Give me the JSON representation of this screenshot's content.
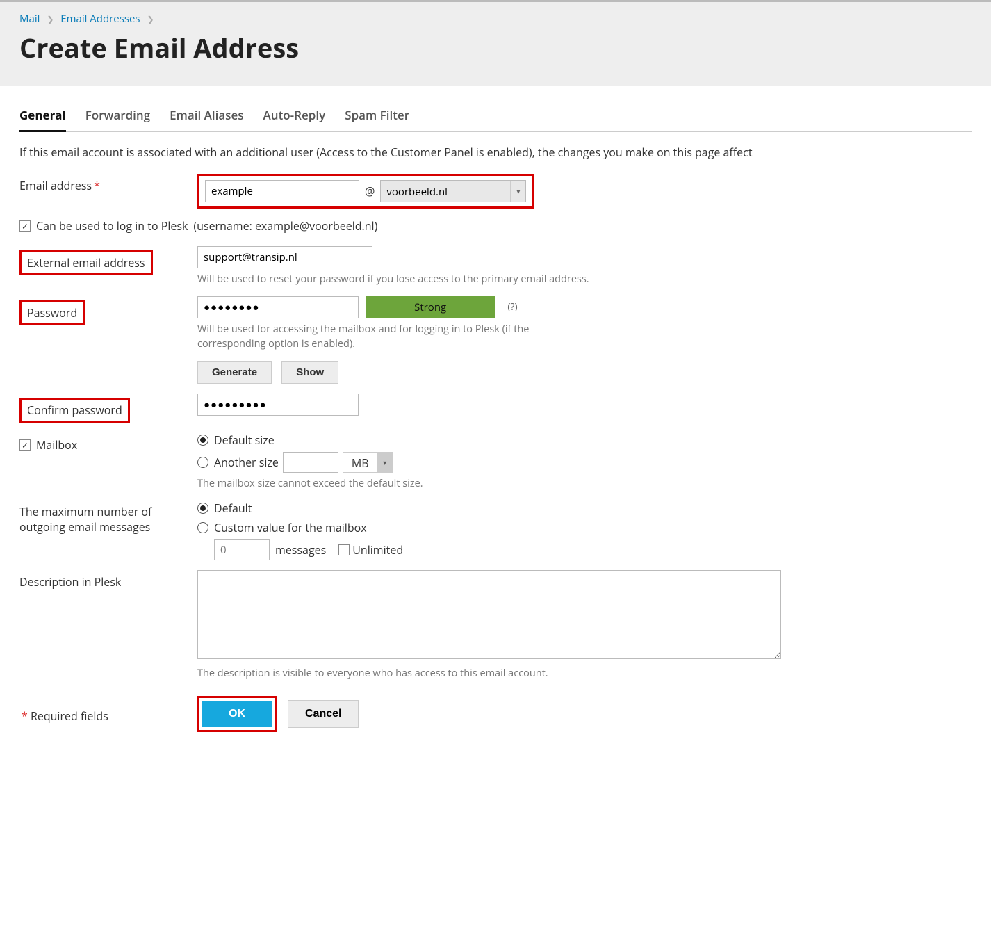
{
  "breadcrumb": {
    "mail": "Mail",
    "emailAddresses": "Email Addresses"
  },
  "pageTitle": "Create Email Address",
  "tabs": [
    "General",
    "Forwarding",
    "Email Aliases",
    "Auto-Reply",
    "Spam Filter"
  ],
  "intro": "If this email account is associated with an additional user (Access to the Customer Panel is enabled), the changes you make on this page affect",
  "labels": {
    "emailAddress": "Email address",
    "canLogin": "Can be used to log in to Plesk",
    "usernameNote": "(username: example@voorbeeld.nl)",
    "externalEmail": "External email address",
    "externalHint": "Will be used to reset your password if you lose access to the primary email address.",
    "password": "Password",
    "passwordHint": "Will be used for accessing the mailbox and for logging in to Plesk (if the corresponding option is enabled).",
    "confirmPassword": "Confirm password",
    "mailbox": "Mailbox",
    "defaultSize": "Default size",
    "anotherSize": "Another size",
    "unit": "MB",
    "sizeHint": "The mailbox size cannot exceed the default size.",
    "maxOutgoing": "The maximum number of outgoing email messages",
    "defaultOpt": "Default",
    "customOpt": "Custom value for the mailbox",
    "messages": "messages",
    "unlimited": "Unlimited",
    "description": "Description in Plesk",
    "descriptionHint": "The description is visible to everyone who has access to this email account.",
    "requiredFields": "Required fields"
  },
  "values": {
    "localPart": "example",
    "domain": "voorbeeld.nl",
    "externalEmail": "support@transip.nl",
    "passwordDots": "●●●●●●●●",
    "confirmDots": "●●●●●●●●●",
    "customMsgPlaceholder": "0"
  },
  "buttons": {
    "strength": "Strong",
    "help": "(?)",
    "generate": "Generate",
    "show": "Show",
    "ok": "OK",
    "cancel": "Cancel"
  }
}
